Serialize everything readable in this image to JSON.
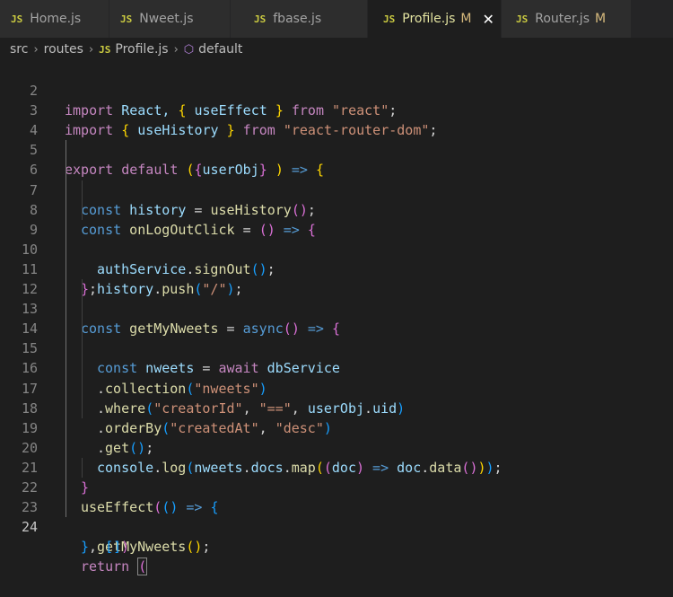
{
  "tabs": [
    {
      "icon": "JS",
      "label": "Home.js"
    },
    {
      "icon": "JS",
      "label": "Nweet.js"
    },
    {
      "icon": "JS",
      "label": "fbase.js"
    },
    {
      "icon": "JS",
      "label": "Profile.js",
      "modified": "M",
      "close": "✕"
    },
    {
      "icon": "JS",
      "label": "Router.js",
      "modified": "M"
    }
  ],
  "breadcrumb": {
    "seg1": "src",
    "sep": "›",
    "seg2": "routes",
    "file_icon": "JS",
    "file": "Profile.js",
    "symbol_icon": "⬡",
    "symbol": "default"
  },
  "line_numbers": [
    "2",
    "3",
    "4",
    "5",
    "6",
    "7",
    "8",
    "9",
    "10",
    "11",
    "12",
    "13",
    "14",
    "15",
    "16",
    "17",
    "18",
    "19",
    "20",
    "21",
    "22",
    "23",
    "24"
  ],
  "code": {
    "l2": [
      "import",
      " React, ",
      "{",
      " useEffect ",
      "}",
      " from ",
      "\"react\"",
      ";"
    ],
    "l3": [
      "import",
      " ",
      "{",
      " useHistory ",
      "}",
      " from ",
      "\"react-router-dom\"",
      ";"
    ],
    "l5": [
      "export",
      " ",
      "default",
      " ",
      "(",
      "{",
      "userObj",
      "}",
      " ",
      ")",
      " => ",
      "{"
    ],
    "l6": [
      "const",
      " history",
      " = ",
      "useHistory",
      "(",
      ")",
      ";"
    ],
    "l7": [
      "const",
      " onLogOutClick",
      " = ",
      "(",
      ")",
      " => ",
      "{"
    ],
    "l8": [
      "authService",
      ".",
      "signOut",
      "(",
      ")",
      ";"
    ],
    "l9": [
      "history",
      ".",
      "push",
      "(",
      "\"/\"",
      ")",
      ";"
    ],
    "l10": [
      "}",
      ";"
    ],
    "l12": [
      "const",
      " getMyNweets",
      " = ",
      "async",
      "(",
      ")",
      " => ",
      "{"
    ],
    "l13": [
      "const",
      " nweets",
      " = ",
      "await",
      " dbService"
    ],
    "l14": [
      ".",
      "collection",
      "(",
      "\"nweets\"",
      ")"
    ],
    "l15": [
      ".",
      "where",
      "(",
      "\"creatorId\"",
      ", ",
      "\"==\"",
      ", ",
      "userObj",
      ".",
      "uid",
      ")"
    ],
    "l16": [
      ".",
      "orderBy",
      "(",
      "\"createdAt\"",
      ", ",
      "\"desc\"",
      ")"
    ],
    "l17": [
      ".",
      "get",
      "(",
      ")",
      ";"
    ],
    "l18": [
      "console",
      ".",
      "log",
      "(",
      "nweets",
      ".",
      "docs",
      ".",
      "map",
      "(",
      "(",
      "doc",
      ")",
      " => ",
      "doc",
      ".",
      "data",
      "(",
      ")",
      ")",
      ")",
      ";"
    ],
    "l20": [
      "}"
    ],
    "l21": [
      "useEffect",
      "(",
      "(",
      ")",
      " => ",
      "{"
    ],
    "l22": [
      "getMyNweets",
      "(",
      ")",
      ";"
    ],
    "l23": [
      "}",
      ", ",
      "[",
      "]",
      ")"
    ],
    "l24": [
      "return",
      " ",
      "("
    ]
  }
}
